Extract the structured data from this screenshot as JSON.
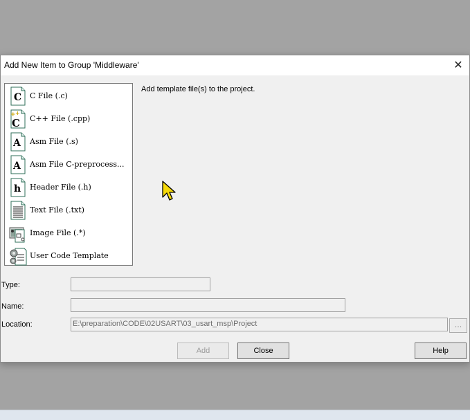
{
  "dialog": {
    "title": "Add New Item to Group 'Middleware'",
    "close_glyph": "✕",
    "description": "Add template file(s) to the project."
  },
  "file_types": [
    {
      "label": "C File (.c)",
      "icon": "c-file-icon"
    },
    {
      "label": "C++ File (.cpp)",
      "icon": "cpp-file-icon"
    },
    {
      "label": "Asm File (.s)",
      "icon": "asm-file-icon"
    },
    {
      "label": "Asm File C-preprocess...",
      "icon": "asm-preprocess-file-icon"
    },
    {
      "label": "Header File (.h)",
      "icon": "header-file-icon"
    },
    {
      "label": "Text File (.txt)",
      "icon": "text-file-icon"
    },
    {
      "label": "Image File (.*)",
      "icon": "image-file-icon"
    },
    {
      "label": "User Code Template",
      "icon": "user-code-template-icon"
    }
  ],
  "form": {
    "type_label": "Type:",
    "type_value": "",
    "name_label": "Name:",
    "name_value": "",
    "location_label": "Location:",
    "location_value": "E:\\preparation\\CODE\\02USART\\03_usart_msp\\Project",
    "browse_label": "..."
  },
  "buttons": {
    "add": "Add",
    "close": "Close",
    "help": "Help"
  },
  "colors": {
    "dialog_bg": "#f0f0f0",
    "titlebar_bg": "#ffffff",
    "desktop_bg": "#a3a3a3",
    "cursor_fill": "#f5d90a"
  }
}
